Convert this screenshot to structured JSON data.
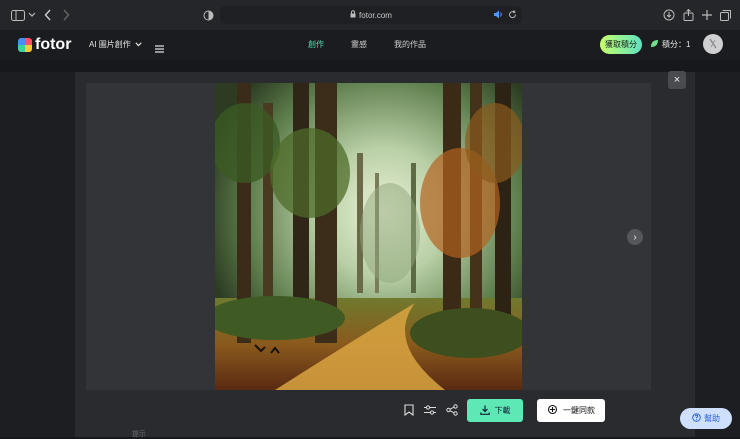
{
  "browser": {
    "url": "fotor.com"
  },
  "header": {
    "logo_text": "fotor",
    "ai_menu_label": "AI 圖片創作",
    "nav": [
      {
        "label": "創作",
        "active": true
      },
      {
        "label": "靈感",
        "active": false
      },
      {
        "label": "我的作品",
        "active": false
      }
    ],
    "earn_button_label": "獲取積分",
    "points_label": "積分：1"
  },
  "viewer": {
    "close_symbol": "×",
    "next_symbol": "›",
    "download_label": "下載",
    "same_style_label": "一鍵同款"
  },
  "help_label": "幫助",
  "bottom_hint": "提示",
  "colors": {
    "accent_green": "#5ee8b5",
    "active_nav": "#53e0b3",
    "help_blue": "#2b62d8"
  }
}
